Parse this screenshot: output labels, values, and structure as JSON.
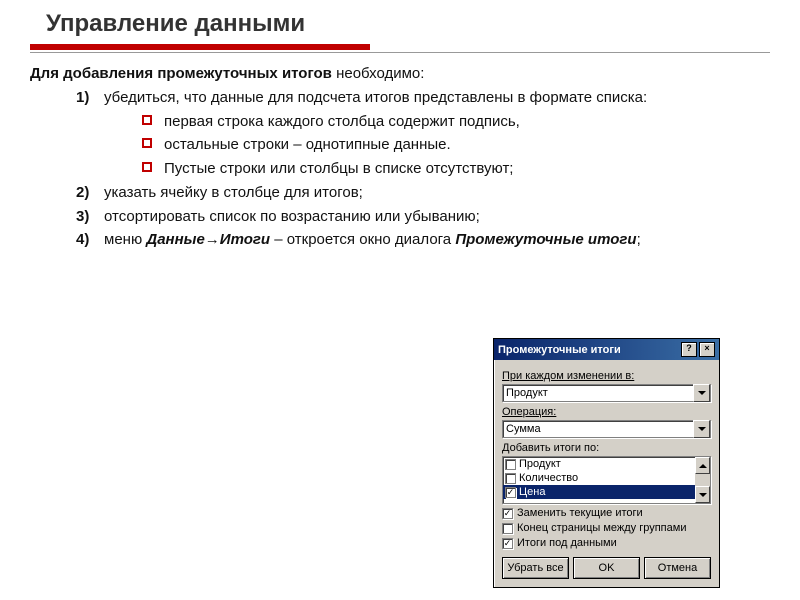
{
  "title": "Управление данными",
  "intro_prefix": "Для добавления промежуточных итогов",
  "intro_suffix": " необходимо:",
  "steps": {
    "s1": "убедиться, что данные для подсчета итогов представлены в формате списка:",
    "bullets": {
      "b1": "первая строка каждого столбца содержит подпись,",
      "b2": "остальные строки – однотипные данные.",
      "b3": "Пустые строки или столбцы в списке отсутствуют;"
    },
    "s2": "указать ячейку в столбце для итогов;",
    "s3": "отсортировать список по возрастанию или убыванию;",
    "s4_pre": "меню ",
    "s4_menu": "Данные→Итоги",
    "s4_mid": " – откроется окно диалога ",
    "s4_dlg": "Промежуточные итоги",
    "s4_post": ";"
  },
  "dialog": {
    "title": "Промежуточные итоги",
    "help": "?",
    "close": "×",
    "label_change": "При каждом изменении в:",
    "combo_change": "Продукт",
    "label_op": "Операция:",
    "combo_op": "Сумма",
    "label_add": "Добавить итоги по:",
    "list": {
      "i1": "Продукт",
      "i2": "Количество",
      "i3": "Цена"
    },
    "chk_replace": "Заменить текущие итоги",
    "chk_pagebreak": "Конец страницы между группами",
    "chk_under": "Итоги под данными",
    "btn_removeall": "Убрать все",
    "btn_ok": "OK",
    "btn_cancel": "Отмена"
  }
}
